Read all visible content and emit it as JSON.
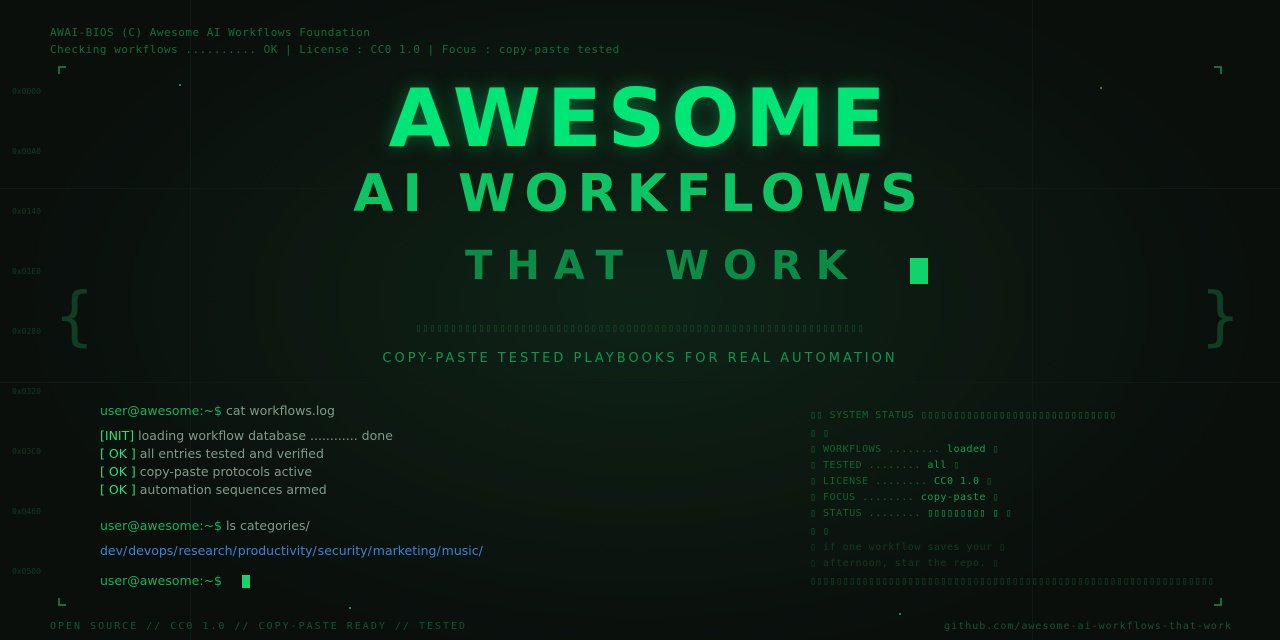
{
  "bios": {
    "line1": "AWAI-BIOS (C) Awesome AI Workflows Foundation",
    "line2": "Checking workflows .......... OK | License : CC0 1.0 | Focus : copy-paste tested"
  },
  "addresses": [
    "0x0000",
    "0x00A0",
    "0x0140",
    "0x01E0",
    "0x0280",
    "0x0320",
    "0x03C0",
    "0x0460",
    "0x0500"
  ],
  "hero": {
    "title": "AWESOME",
    "subtitle": "AI WORKFLOWS",
    "tagline_big": "THAT WORK",
    "box_row": "▯▯▯▯▯▯▯▯▯▯▯▯▯▯▯▯▯▯▯▯▯▯▯▯▯▯▯▯▯▯▯▯▯▯▯▯▯▯▯▯▯▯▯▯▯▯▯▯▯▯▯▯▯▯▯▯▯▯▯▯▯▯▯▯",
    "tagline": "COPY-PASTE TESTED PLAYBOOKS FOR REAL AUTOMATION"
  },
  "braces": {
    "left": "{",
    "right": "}"
  },
  "terminal": {
    "prompt": "user@awesome:~$",
    "cmd1": "cat workflows.log",
    "log": [
      {
        "tag": "[INIT]",
        "text": "loading workflow database ............ done"
      },
      {
        "tag": "[ OK ]",
        "text": "all entries tested and verified"
      },
      {
        "tag": "[ OK ]",
        "text": "copy-paste protocols active"
      },
      {
        "tag": "[ OK ]",
        "text": "automation sequences armed"
      }
    ],
    "cmd2": "ls categories/",
    "dirs": "dev/  devops/  research/  productivity/  security/  marketing/  music/"
  },
  "status": {
    "header": "▯▯ SYSTEM STATUS ▯▯▯▯▯▯▯▯▯▯▯▯▯▯▯▯▯▯▯▯▯▯▯▯▯▯▯▯▯▯",
    "blank": "▯ ▯",
    "rows": [
      {
        "label": "▯ WORKFLOWS ........",
        "value": "loaded",
        "end": "▯"
      },
      {
        "label": "▯ TESTED ........",
        "value": "all",
        "end": "▯"
      },
      {
        "label": "▯ LICENSE ........",
        "value": "CC0 1.0",
        "end": "▯"
      },
      {
        "label": "▯ FOCUS ........",
        "value": "copy-paste",
        "end": "▯"
      },
      {
        "label": "▯ STATUS ........",
        "value": "▯▯▯▯▯▯▯▯▯ ▯",
        "end": "▯"
      }
    ],
    "note1": "▯ if one workflow saves your ▯",
    "note2": "▯ afternoon, star the repo. ▯",
    "footer": "▯▯▯▯▯▯▯▯▯▯▯▯▯▯▯▯▯▯▯▯▯▯▯▯▯▯▯▯▯▯▯▯▯▯▯▯▯▯▯▯▯▯▯▯▯▯▯▯▯▯▯▯▯▯▯▯▯▯▯▯▯▯"
  },
  "footer": {
    "left": "OPEN SOURCE // CC0 1.0 // COPY-PASTE READY // TESTED",
    "right": "github.com/awesome-ai-workflows-that-work"
  }
}
